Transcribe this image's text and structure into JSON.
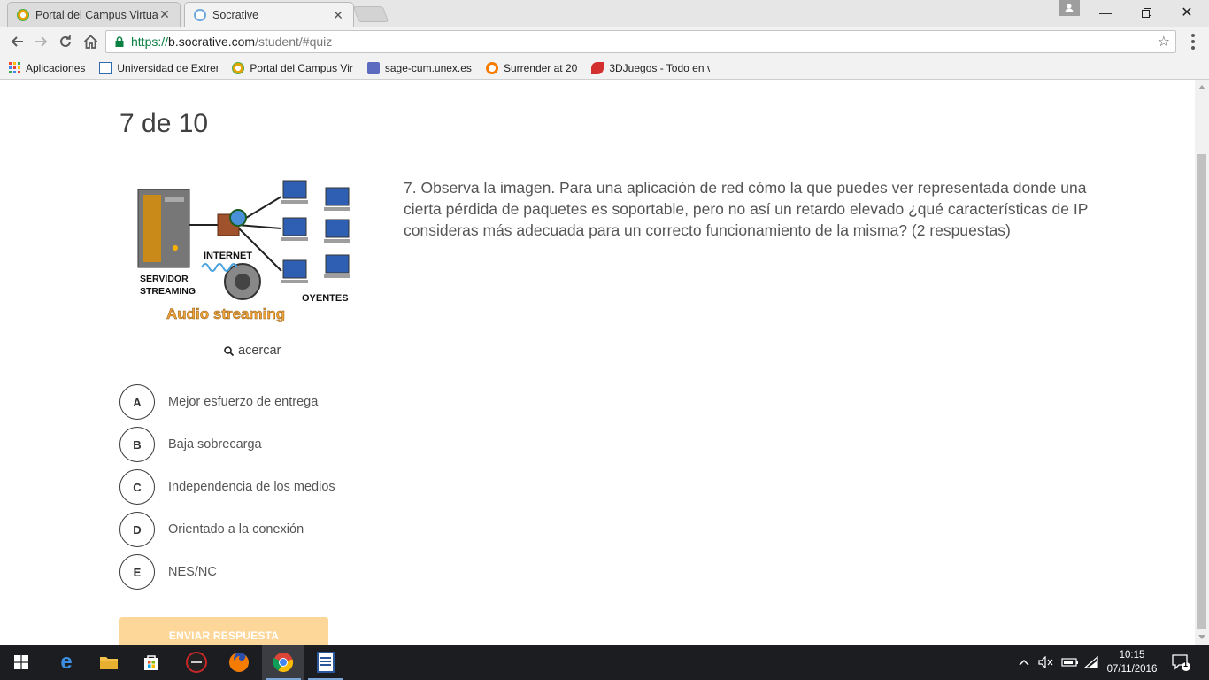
{
  "browser": {
    "tabs": [
      {
        "title": "Portal del Campus Virtua",
        "active": false,
        "icon": "campus-favicon"
      },
      {
        "title": "Socrative",
        "active": true,
        "icon": "socrative-favicon"
      }
    ],
    "url": {
      "scheme": "https://",
      "host": "b.socrative.com",
      "path": "/student/#quiz"
    },
    "bookmarks": [
      {
        "label": "Aplicaciones",
        "icon": "apps-grid-icon"
      },
      {
        "label": "Universidad de Extrem",
        "icon": "university-icon"
      },
      {
        "label": "Portal del Campus Vir",
        "icon": "campus-favicon"
      },
      {
        "label": "sage-cum.unex.es",
        "icon": "sage-icon"
      },
      {
        "label": "Surrender at 20",
        "icon": "surrender-icon"
      },
      {
        "label": "3DJuegos - Todo en v",
        "icon": "3djuegos-icon"
      }
    ]
  },
  "quiz": {
    "progress": "7 de 10",
    "image_text": {
      "internet": "INTERNET",
      "server_line1": "SERVIDOR",
      "server_line2": "STREAMING",
      "listeners": "OYENTES",
      "caption": "Audio streaming"
    },
    "zoom_label": "acercar",
    "question": "7. Observa la imagen. Para una aplicación de red cómo la que puedes ver representada donde una cierta pérdida de paquetes es soportable, pero no así un retardo elevado ¿qué características de IP consideras más adecuada para un correcto funcionamiento de la misma? (2 respuestas)",
    "answers": [
      {
        "letter": "A",
        "text": "Mejor esfuerzo de entrega"
      },
      {
        "letter": "B",
        "text": "Baja sobrecarga"
      },
      {
        "letter": "C",
        "text": "Independencia de los medios"
      },
      {
        "letter": "D",
        "text": "Orientado a la conexión"
      },
      {
        "letter": "E",
        "text": "NES/NC"
      }
    ],
    "submit_label": "ENVIAR RESPUESTA"
  },
  "taskbar": {
    "time": "10:15",
    "date": "07/11/2016",
    "notification_count": "1"
  },
  "colors": {
    "submit_bg": "#fdd799",
    "https_green": "#0b8043",
    "taskbar_bg": "#1b1d21"
  }
}
